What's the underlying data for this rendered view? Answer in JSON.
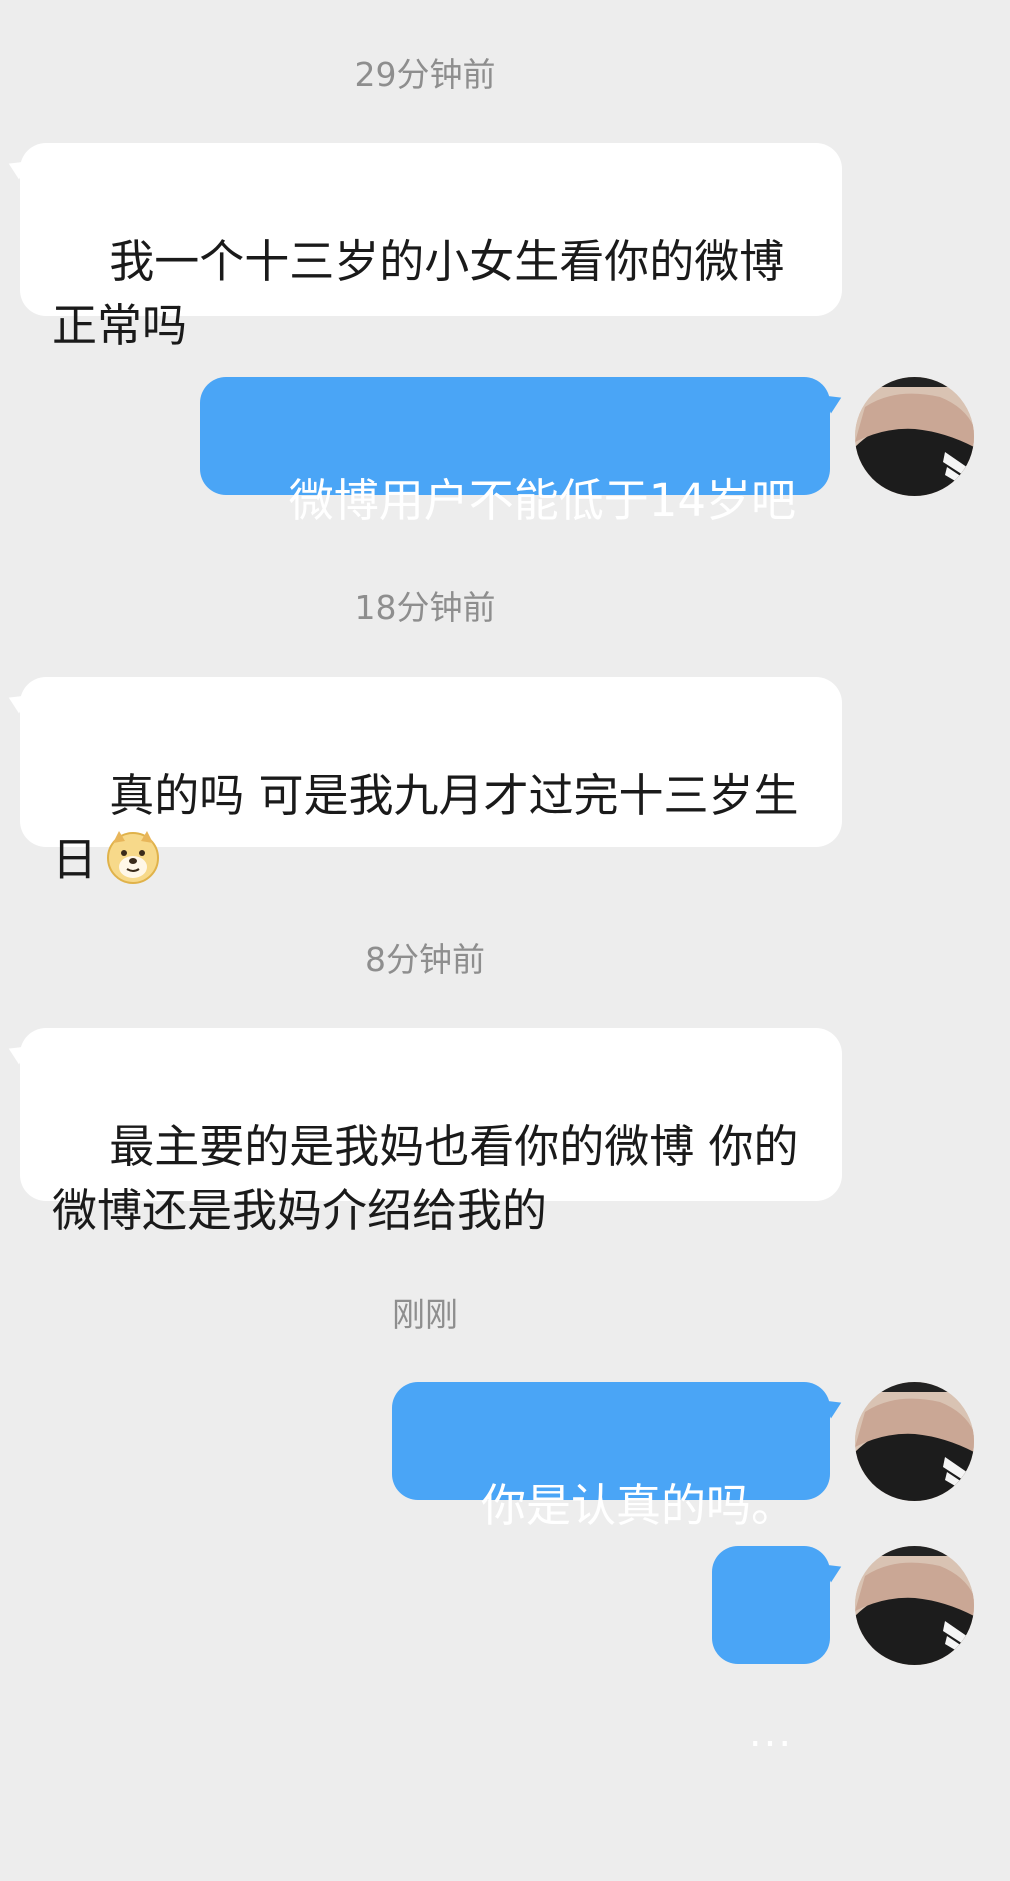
{
  "messages": [
    {
      "type": "timestamp",
      "text": "29分钟前"
    },
    {
      "type": "incoming",
      "text": "我一个十三岁的小女生看你的微博正常吗"
    },
    {
      "type": "outgoing",
      "text": "微博用户不能低于14岁吧"
    },
    {
      "type": "timestamp",
      "text": "18分钟前"
    },
    {
      "type": "incoming",
      "text": "真的吗 可是我九月才过完十三岁生日",
      "emoji": "doge-emoji"
    },
    {
      "type": "timestamp",
      "text": "8分钟前"
    },
    {
      "type": "incoming",
      "text": "最主要的是我妈也看你的微博 你的微博还是我妈介绍给我的"
    },
    {
      "type": "timestamp",
      "text": "刚刚"
    },
    {
      "type": "outgoing",
      "text": "你是认真的吗。"
    },
    {
      "type": "outgoing",
      "text": "..."
    }
  ],
  "colors": {
    "background": "#ededed",
    "incoming_bubble": "#ffffff",
    "outgoing_bubble": "#4aa5f6",
    "timestamp": "#8e8e8e"
  }
}
